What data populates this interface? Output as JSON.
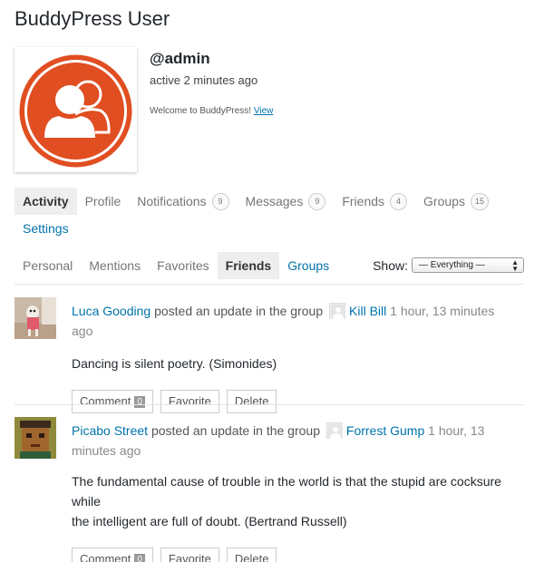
{
  "page": {
    "title": "BuddyPress User"
  },
  "profile": {
    "username": "@admin",
    "last_active": "active 2 minutes ago",
    "welcome_text": "Welcome to BuddyPress!",
    "welcome_link": "View",
    "avatar_icon": "user-group-icon",
    "avatar_color": "#e04e21"
  },
  "primary_nav": {
    "tabs": [
      {
        "label": "Activity",
        "count": null
      },
      {
        "label": "Profile",
        "count": null
      },
      {
        "label": "Notifications",
        "count": "9"
      },
      {
        "label": "Messages",
        "count": "9"
      },
      {
        "label": "Friends",
        "count": "4"
      },
      {
        "label": "Groups",
        "count": "15"
      }
    ],
    "settings_label": "Settings"
  },
  "sub_nav": {
    "tabs": [
      "Personal",
      "Mentions",
      "Favorites",
      "Friends",
      "Groups"
    ],
    "show_label": "Show:",
    "filter_value": "— Everything —"
  },
  "activities": [
    {
      "user": "Luca Gooding",
      "action": "posted an update in the group",
      "group": "Kill Bill",
      "time": "1 hour, 13 minutes ago",
      "content": "Dancing is silent poetry. (Simonides)",
      "comment_label": "Comment",
      "comment_count": "0",
      "favorite_label": "Favorite",
      "delete_label": "Delete"
    },
    {
      "user": "Picabo Street",
      "action": "posted an update in the group",
      "group": "Forrest Gump",
      "time_part1": "1 hour, 13 minutes",
      "time_part2": "ago",
      "content_line1": "The fundamental cause of trouble in the world is that the stupid are cocksure while",
      "content_line2": "the intelligent are full of doubt. (Bertrand Russell)",
      "comment_label": "Comment",
      "comment_count": "0",
      "favorite_label": "Favorite",
      "delete_label": "Delete"
    }
  ]
}
